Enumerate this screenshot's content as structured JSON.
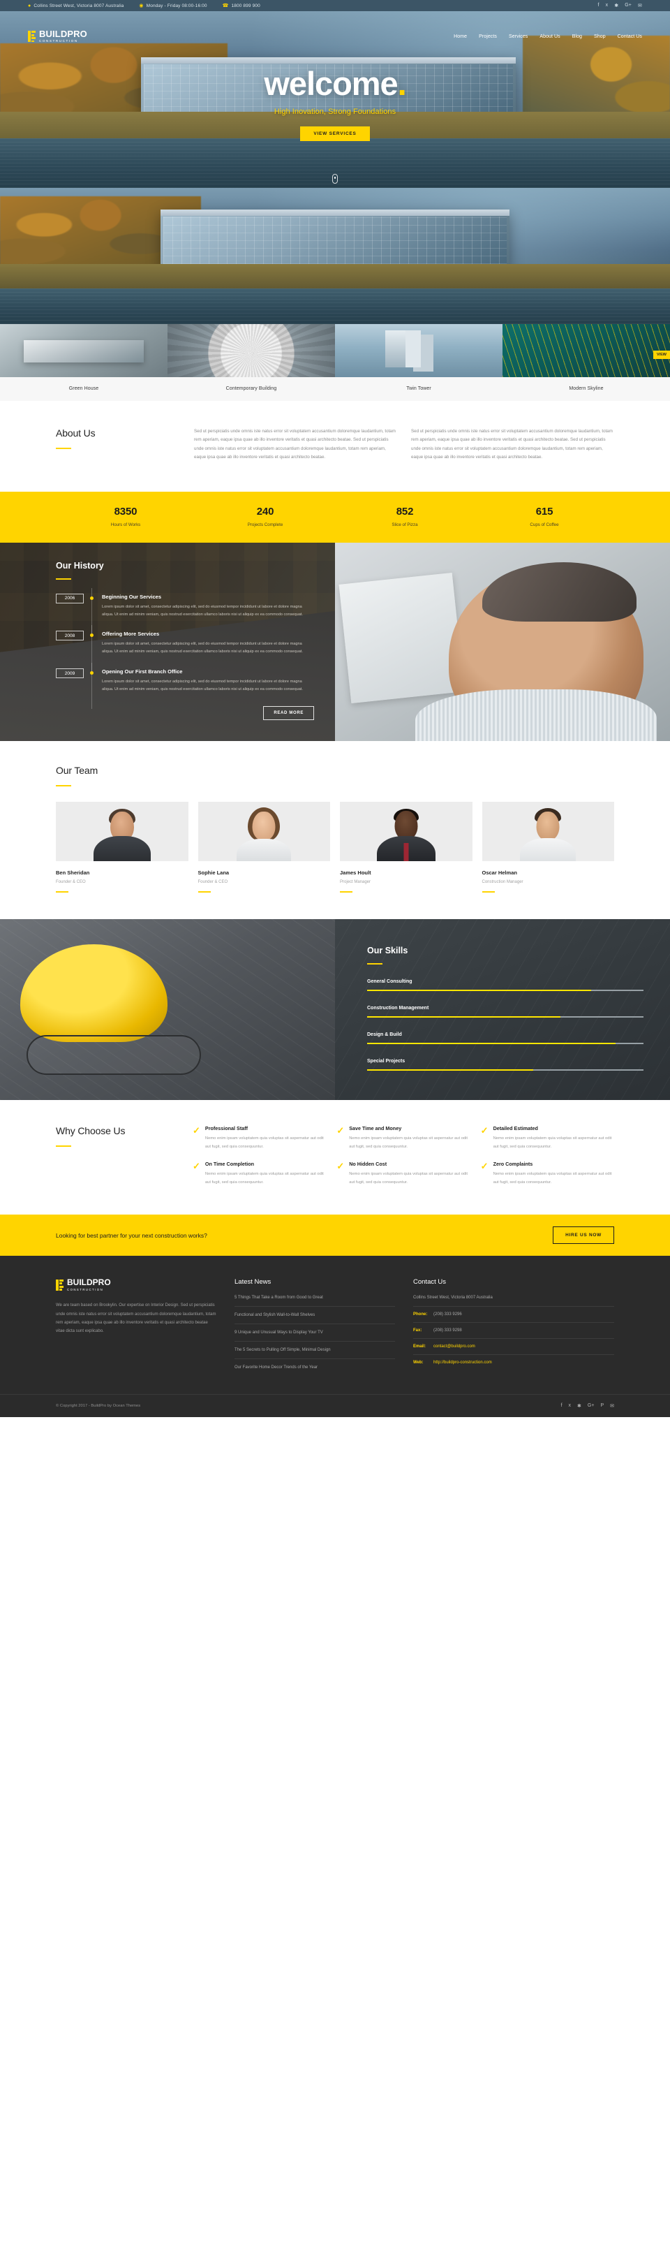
{
  "topbar": {
    "address": "Collins Street West, Victoria 8007 Australia",
    "hours": "Monday - Friday 08:00-16:00",
    "phone": "1800 899 900",
    "address_icon": "location-pin-icon",
    "hours_icon": "clock-icon",
    "phone_icon": "phone-icon",
    "social": [
      "facebook-icon",
      "twitter-icon",
      "dribbble-icon",
      "google-plus-icon",
      "email-icon"
    ]
  },
  "brand": {
    "name": "BUILDPRO",
    "tagline": "CONSTRUCTION"
  },
  "nav": [
    {
      "label": "Home"
    },
    {
      "label": "Projects"
    },
    {
      "label": "Services"
    },
    {
      "label": "About Us"
    },
    {
      "label": "Blog"
    },
    {
      "label": "Shop"
    },
    {
      "label": "Contact Us"
    }
  ],
  "hero": {
    "title": "welcome",
    "title_dot": ".",
    "subtitle": "High Inovation, Strong Foundations",
    "cta": "VIEW SERVICES"
  },
  "portfolio": {
    "badge": "VIEW",
    "items": [
      {
        "title": "Green House"
      },
      {
        "title": "Contemporary Building"
      },
      {
        "title": "Twin Tower"
      },
      {
        "title": "Modern Skyline"
      }
    ]
  },
  "about": {
    "title": "About Us",
    "col1": "Sed ut perspiciatis unde omnis iste natus error sit voluptatem accusantium doloremque laudantium, totam rem aperiam, eaque ipsa quae ab illo inventore veritatis et quasi architecto beatae. Sed ut perspiciatis unde omnis iste natus error sit voluptatem accusantium doloremque laudantium, totam rem aperiam, eaque ipsa quae ab illo inventore veritatis et quasi architecto beatae.",
    "col2": "Sed ut perspiciatis unde omnis iste natus error sit voluptatem accusantium doloremque laudantium, totam rem aperiam, eaque ipsa quae ab illo inventore veritatis et quasi architecto beatae. Sed ut perspiciatis unde omnis iste natus error sit voluptatem accusantium doloremque laudantium, totam rem aperiam, eaque ipsa quae ab illo inventore veritatis et quasi architecto beatae."
  },
  "counters": [
    {
      "value": "8350",
      "label": "Hours of Works"
    },
    {
      "value": "240",
      "label": "Projects Complete"
    },
    {
      "value": "852",
      "label": "Slice of Pizza"
    },
    {
      "value": "615",
      "label": "Cups of Coffee"
    }
  ],
  "history": {
    "title": "Our History",
    "read_more": "READ MORE",
    "items": [
      {
        "year": "2006",
        "heading": "Beginning Our Services",
        "text": "Lorem ipsum dolor sit amet, consectetur adipiscing elit, sed do eiusmod tempor incididunt ut labore et dolore magna aliqua. Ut enim ad minim veniam, quis nostrud exercitation ullamco laboris nisi ut aliquip ex ea commodo consequat."
      },
      {
        "year": "2008",
        "heading": "Offering More Services",
        "text": "Lorem ipsum dolor sit amet, consectetur adipiscing elit, sed do eiusmod tempor incididunt ut labore et dolore magna aliqua. Ut enim ad minim veniam, quis nostrud exercitation ullamco laboris nisi ut aliquip ex ea commodo consequat."
      },
      {
        "year": "2009",
        "heading": "Opening Our First Branch Office",
        "text": "Lorem ipsum dolor sit amet, consectetur adipiscing elit, sed do eiusmod tempor incididunt ut labore et dolore magna aliqua. Ut enim ad minim veniam, quis nostrud exercitation ullamco laboris nisi ut aliquip ex ea commodo consequat."
      }
    ]
  },
  "team": {
    "title": "Our Team",
    "members": [
      {
        "name": "Ben Sheridan",
        "role": "Founder & CEO"
      },
      {
        "name": "Sophie Lana",
        "role": "Founder & CEO"
      },
      {
        "name": "James Hoult",
        "role": "Project Manager"
      },
      {
        "name": "Oscar Helman",
        "role": "Construction Manager"
      }
    ]
  },
  "skills": {
    "title": "Our Skills",
    "items": [
      {
        "name": "General Consulting",
        "percent": 81
      },
      {
        "name": "Construction Management",
        "percent": 70
      },
      {
        "name": "Design & Build",
        "percent": 90
      },
      {
        "name": "Special Projects",
        "percent": 60
      }
    ]
  },
  "why": {
    "title": "Why Choose Us",
    "check_icon": "check-mark-icon",
    "items": [
      {
        "heading": "Professional Staff",
        "text": "Nemo enim ipsam voluptatem quia voluptas sit aspernatur aut odit aut fugit, sed quia consequuntur."
      },
      {
        "heading": "Save Time and Money",
        "text": "Nemo enim ipsam voluptatem quia voluptas sit aspernatur aut odit aut fugit, sed quia consequuntur."
      },
      {
        "heading": "Detailed Estimated",
        "text": "Nemo enim ipsam voluptatem quia voluptas sit aspernatur aut odit aut fugit, sed quia consequuntur."
      },
      {
        "heading": "On Time Completion",
        "text": "Nemo enim ipsam voluptatem quia voluptas sit aspernatur aut odit aut fugit, sed quia consequuntur."
      },
      {
        "heading": "No Hidden Cost",
        "text": "Nemo enim ipsam voluptatem quia voluptas sit aspernatur aut odit aut fugit, sed quia consequuntur."
      },
      {
        "heading": "Zero Complaints",
        "text": "Nemo enim ipsam voluptatem quia voluptas sit aspernatur aut odit aut fugit, sed quia consequuntur."
      }
    ]
  },
  "cta": {
    "text": "Looking for best partner for your next construction works?",
    "button": "HIRE US NOW"
  },
  "footer": {
    "about": "We are team based on Brookylin. Our expertise on Interior Design. Sed ut perspiciatis unde omnis iste natus error sit voluptatem accusantium doloremque laudantium, totam rem aperiam, eaque ipsa quae ab illo inventore veritatis et quasi architecto beatae vitae dicta sunt explicabo.",
    "news_title": "Latest News",
    "news": [
      "5 Things That Take a Room from Good to Great",
      "Functional and Stylish Wall-to-Wall Shelves",
      "9 Unique and Unusual Ways to Display Your TV",
      "The 5 Secrets to Pulling Off Simple, Minimal Design",
      "Our Favorite Home Decor Trends of the Year"
    ],
    "contact_title": "Contact Us",
    "contact_address": "Collins Street West, Victoria 8007 Australia",
    "rows": [
      {
        "key": "Phone:",
        "value": "(208) 333 9296",
        "link": false
      },
      {
        "key": "Fax:",
        "value": "(208) 333 9298",
        "link": false
      },
      {
        "key": "Email:",
        "value": "contact@buildpro.com",
        "link": true
      },
      {
        "key": "Web:",
        "value": "http://buildpro-construction.com",
        "link": true
      }
    ]
  },
  "copyright": {
    "text": "© Copyright 2017 - BuildPro by Ocean Themes",
    "social": [
      "facebook-icon",
      "twitter-icon",
      "dribbble-icon",
      "google-plus-icon",
      "pinterest-icon",
      "email-icon"
    ]
  },
  "colors": {
    "accent": "#ffd400",
    "dark": "#2b2b2b",
    "topbar": "#3c5566"
  }
}
